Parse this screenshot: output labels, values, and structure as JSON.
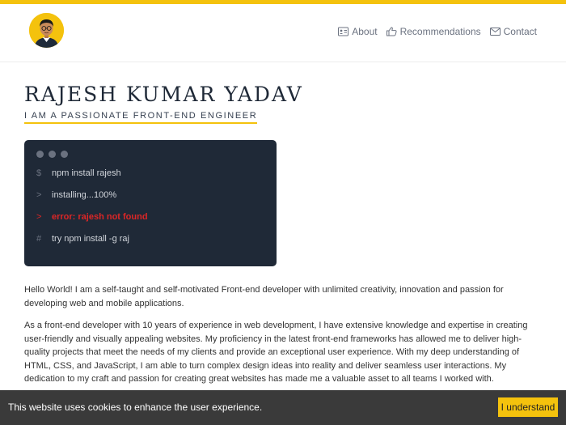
{
  "header": {
    "nav": [
      {
        "label": "About",
        "icon": "id-card-icon"
      },
      {
        "label": "Recommendations",
        "icon": "thumbs-up-icon"
      },
      {
        "label": "Contact",
        "icon": "envelope-icon"
      }
    ]
  },
  "hero": {
    "name": "RAJESH KUMAR YADAV",
    "tagline": "I AM A PASSIONATE FRONT-END ENGINEER"
  },
  "terminal": {
    "lines": [
      {
        "prompt": "$",
        "text": "npm install rajesh"
      },
      {
        "prompt": ">",
        "text": "installing...100%"
      },
      {
        "prompt": ">",
        "text": "error: rajesh not found"
      },
      {
        "prompt": "#",
        "text": "try npm install -g raj"
      }
    ]
  },
  "about": {
    "paragraph1": "Hello World! I am a self-taught and self-motivated Front-end developer with unlimited creativity, innovation and passion for developing web and mobile applications.",
    "paragraph2": "As a front-end developer with 10 years of experience in web development, I have extensive knowledge and expertise in creating user-friendly and visually appealing websites. My proficiency in the latest front-end frameworks has allowed me to deliver high-quality projects that meet the needs of my clients and provide an exceptional user experience. With my deep understanding of HTML, CSS, and JavaScript, I am able to turn complex design ideas into reality and deliver seamless user interactions. My dedication to my craft and passion for creating great websites has made me a valuable asset to all teams I worked with."
  },
  "cookie": {
    "message": "This website uses cookies to enhance the user experience.",
    "button": "I understand"
  },
  "colors": {
    "accent": "#f4c20d",
    "terminal_bg": "#1f2937",
    "error": "#dc2626"
  }
}
